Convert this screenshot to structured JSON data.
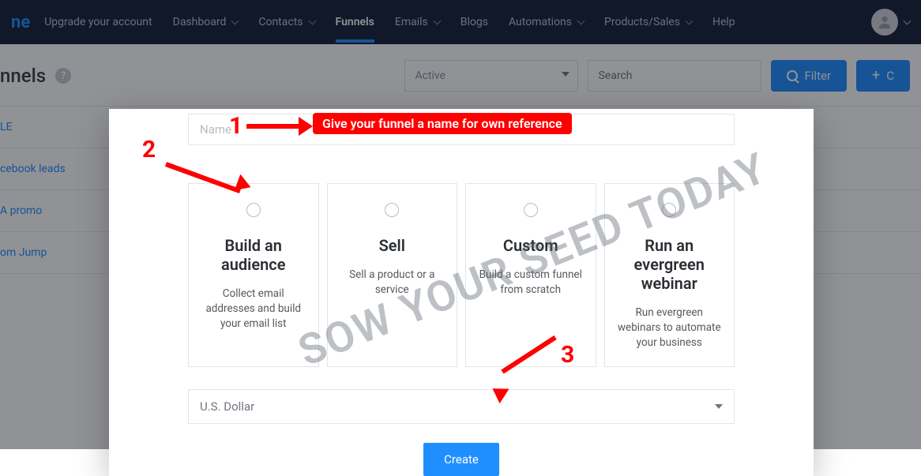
{
  "nav": {
    "brand_fragment": "ne",
    "items": [
      {
        "label": "Upgrade your account",
        "chev": false
      },
      {
        "label": "Dashboard",
        "chev": true
      },
      {
        "label": "Contacts",
        "chev": true
      },
      {
        "label": "Funnels",
        "chev": false,
        "active": true
      },
      {
        "label": "Emails",
        "chev": true
      },
      {
        "label": "Blogs",
        "chev": false
      },
      {
        "label": "Automations",
        "chev": true
      },
      {
        "label": "Products/Sales",
        "chev": true
      },
      {
        "label": "Help",
        "chev": false
      }
    ]
  },
  "page": {
    "title_fragment": "nnels",
    "status_dropdown": "Active",
    "search_placeholder": "Search",
    "filter_label": "Filter",
    "create_label": "C"
  },
  "sidebar_rows": [
    "LE",
    "cebook leads",
    "A promo",
    "om Jump"
  ],
  "modal": {
    "name_placeholder": "Name",
    "options": [
      {
        "title": "Build an audience",
        "desc": "Collect email addresses and build your email list"
      },
      {
        "title": "Sell",
        "desc": "Sell a product or a service"
      },
      {
        "title": "Custom",
        "desc": "Build a custom funnel from scratch"
      },
      {
        "title": "Run an evergreen webinar",
        "desc": "Run evergreen webinars to automate your business"
      }
    ],
    "currency": "U.S. Dollar",
    "create_btn": "Create"
  },
  "annotations": {
    "n1": "1",
    "n2": "2",
    "n3": "3",
    "tip": "Give your funnel a name for own reference"
  },
  "watermark": "SOW YOUR SEED TODAY"
}
